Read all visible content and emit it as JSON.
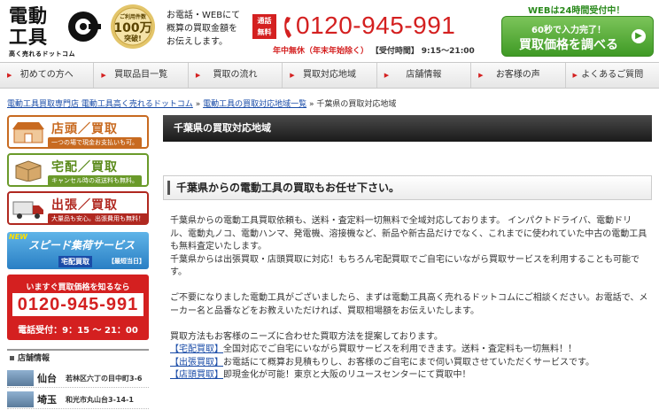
{
  "header": {
    "logo_line1": "電動",
    "logo_line2": "工具",
    "logo_tagline": "高く売れるドットコム",
    "medal_line1": "ご利用件数",
    "medal_line2": "100万",
    "medal_line3": "突破!",
    "desc_lines": [
      "お電話・WEBにて",
      "概算の買取金額を",
      "お伝えします。"
    ],
    "free_badge_line1": "通話",
    "free_badge_line2": "無料",
    "phone": "0120-945-991",
    "hours_red": "年中無休（年末年始除く）",
    "hours_label": "【受付時間】",
    "hours": "9:15～21:00",
    "web24": "WEBは24時間受付中！",
    "cta_small": "60秒で入力完了！",
    "cta_main": "買取価格を調べる"
  },
  "nav": [
    {
      "label": "初めての方へ"
    },
    {
      "label": "買取品目一覧"
    },
    {
      "label": "買取の流れ"
    },
    {
      "label": "買取対応地域"
    },
    {
      "label": "店舗情報"
    },
    {
      "label": "お客様の声"
    },
    {
      "label": "よくあるご質問"
    }
  ],
  "breadcrumb": {
    "link1": "電動工具買取専門店 電動工具高く売れるドットコム",
    "sep": " » ",
    "link2": "電動工具の買取対応地域一覧",
    "current": "千葉県の買取対応地域"
  },
  "sidebar": {
    "store_title": "店頭／買取",
    "store_sub": "一つの場で現金お支払いも可。",
    "deliv_title": "宅配／買取",
    "deliv_sub": "キャンセル時の返送料も無料。",
    "visit_title": "出張／買取",
    "visit_sub": "大量品も安心。出張費用も無料！",
    "speed_new": "NEW",
    "speed_main": "スピード集荷サービス",
    "speed_tag": "宅配買取",
    "speed_tag2": "【最短当日】",
    "phone_ask": "いますぐ買取価格を知るなら",
    "phone_number": "0120-945-991",
    "phone_hours": "電話受付：9：15 ～ 21：00",
    "stores_head": "店舗情報",
    "stores": [
      {
        "city": "仙台",
        "addr": "若林区六丁の目中町3-6"
      },
      {
        "city": "埼玉",
        "addr": "和光市丸山台3-14-1"
      }
    ]
  },
  "main": {
    "title": "千葉県の買取対応地域",
    "subhead": "千葉県からの電動工具の買取もお任せ下さい。",
    "p1": "千葉県からの電動工具買取依頼も、送料・査定料一切無料で全域対応しております。 インパクトドライバ、電動ドリル、電動丸ノコ、電動ハンマ、発電機、溶接機など、新品や新古品だけでなく、これまでに使われていた中古の電動工具も無料査定いたします。",
    "p1b": "千葉県からは出張買取・店頭買取に対応！もちろん宅配買取でご自宅にいながら買取サービスを利用することも可能です。",
    "p2": "ご不要になりました電動工具がございましたら、まずは電動工具高く売れるドットコムにご相談ください。お電話で、メーカー名と品番などをお教えいただければ、買取相場額をお伝えいたします。",
    "p3_intro": "買取方法もお客様のニーズに合わせた買取方法を提案しております。",
    "l1_link": "【宅配買取】",
    "l1_text": "全国対応でご自宅にいながら買取サービスを利用できます。送料・査定料も一切無料！！",
    "l2_link": "【出張買取】",
    "l2_text": "お電話にて概算お見積もりし、お客様のご自宅にまで伺い買取させていただくサービスです。",
    "l3_link": "【店頭買取】",
    "l3_text": "即現金化が可能！東京と大阪のリユースセンターにて買取中！"
  }
}
